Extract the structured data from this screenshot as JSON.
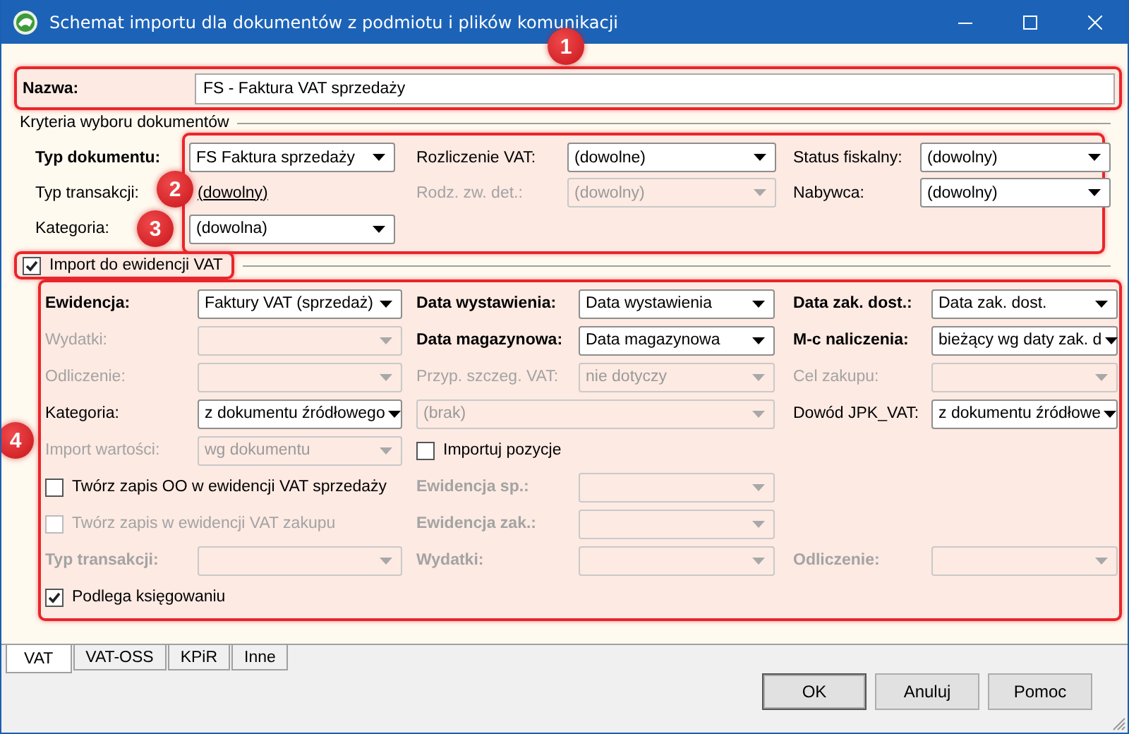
{
  "window": {
    "title": "Schemat importu dla dokumentów z podmiotu i plików komunikacji"
  },
  "annotations": [
    {
      "number": "1"
    },
    {
      "number": "2"
    },
    {
      "number": "3"
    },
    {
      "number": "4"
    }
  ],
  "name_field": {
    "label": "Nazwa:",
    "value": "FS - Faktura VAT sprzedaży"
  },
  "criteria": {
    "title": "Kryteria wyboru dokumentów",
    "rows": [
      [
        {
          "kind": "field",
          "label": "Typ dokumentu:",
          "bold": true,
          "disabled": false,
          "value": "FS Faktura sprzedaży"
        },
        {
          "kind": "field",
          "label": "Rozliczenie VAT:",
          "bold": false,
          "disabled": false,
          "value": "(dowolne)"
        },
        {
          "kind": "field",
          "label": "Status fiskalny:",
          "bold": false,
          "disabled": false,
          "value": "(dowolny)"
        }
      ],
      [
        {
          "kind": "link",
          "label": "Typ transakcji:",
          "bold": false,
          "disabled": false,
          "value": "(dowolny)"
        },
        {
          "kind": "field",
          "label": "Rodz. zw. det.:",
          "bold": false,
          "disabled": true,
          "value": "(dowolny)"
        },
        {
          "kind": "field",
          "label": "Nabywca:",
          "bold": false,
          "disabled": false,
          "value": "(dowolny)"
        }
      ],
      [
        {
          "kind": "field",
          "label": "Kategoria:",
          "bold": false,
          "disabled": false,
          "value": "(dowolna)"
        },
        null,
        null
      ]
    ]
  },
  "vat_import": {
    "label": "Import do ewidencji VAT",
    "checked": true,
    "rows": [
      [
        {
          "kind": "field",
          "label": "Ewidencja:",
          "bold": true,
          "disabled": false,
          "value": "Faktury VAT (sprzedaż)"
        },
        {
          "kind": "field",
          "label": "Data wystawienia:",
          "bold": true,
          "disabled": false,
          "value": "Data wystawienia"
        },
        {
          "kind": "field",
          "label": "Data zak. dost.:",
          "bold": true,
          "disabled": false,
          "value": "Data zak. dost."
        }
      ],
      [
        {
          "kind": "field",
          "label": "Wydatki:",
          "bold": false,
          "disabled": true
        },
        {
          "kind": "field",
          "label": "Data magazynowa:",
          "bold": true,
          "disabled": false,
          "value": "Data magazynowa"
        },
        {
          "kind": "field",
          "label": "M-c naliczenia:",
          "bold": true,
          "disabled": false,
          "value": "bieżący wg daty zak. d"
        }
      ],
      [
        {
          "kind": "field",
          "label": "Odliczenie:",
          "bold": false,
          "disabled": true
        },
        {
          "kind": "field",
          "label": "Przyp. szczeg. VAT:",
          "bold": false,
          "disabled": true,
          "value": "nie dotyczy"
        },
        {
          "kind": "field",
          "label": "Cel zakupu:",
          "bold": false,
          "disabled": true
        }
      ],
      [
        {
          "kind": "field",
          "label": "Kategoria:",
          "bold": false,
          "disabled": false,
          "value": "z dokumentu źródłowego"
        },
        {
          "kind": "wide_combo",
          "disabled": true,
          "value": "(brak)"
        },
        {
          "kind": "field",
          "label": "Dowód JPK_VAT:",
          "bold": false,
          "disabled": false,
          "value": "z dokumentu źródłowe"
        }
      ],
      [
        {
          "kind": "field",
          "label": "Import wartości:",
          "bold": false,
          "disabled": true,
          "value": "wg dokumentu"
        },
        {
          "kind": "checkbox",
          "label": "Importuj pozycje",
          "checked": false,
          "disabled": false
        },
        null
      ],
      [
        {
          "kind": "checkbox",
          "label": "Twórz zapis OO w ewidencji VAT sprzedaży",
          "checked": false,
          "disabled": false
        },
        {
          "kind": "field",
          "label": "Ewidencja sp.:",
          "bold": true,
          "disabled": true
        },
        null
      ],
      [
        {
          "kind": "checkbox",
          "label": "Twórz zapis w ewidencji VAT zakupu",
          "checked": false,
          "disabled": true
        },
        {
          "kind": "field",
          "label": "Ewidencja zak.:",
          "bold": true,
          "disabled": true
        },
        null
      ],
      [
        {
          "kind": "field",
          "label": "Typ transakcji:",
          "bold": true,
          "disabled": true
        },
        {
          "kind": "field",
          "label": "Wydatki:",
          "bold": true,
          "disabled": true
        },
        {
          "kind": "field",
          "label": "Odliczenie:",
          "bold": true,
          "disabled": true
        }
      ],
      [
        {
          "kind": "checkbox",
          "label": "Podlega księgowaniu",
          "checked": true,
          "disabled": false
        },
        null,
        null
      ]
    ]
  },
  "tabs": [
    {
      "label": "VAT",
      "selected": true
    },
    {
      "label": "VAT-OSS",
      "selected": false
    },
    {
      "label": "KPiR",
      "selected": false
    },
    {
      "label": "Inne",
      "selected": false
    }
  ],
  "buttons": [
    "OK",
    "Anuluj",
    "Pomoc"
  ]
}
